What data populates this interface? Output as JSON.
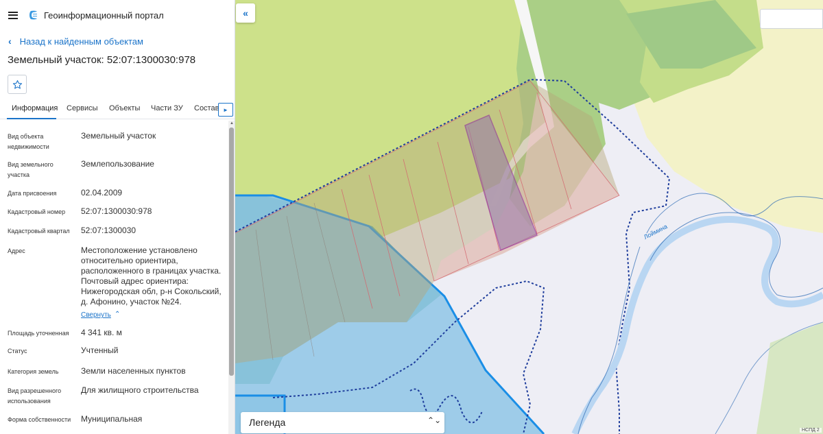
{
  "header": {
    "portal_title": "Геоинформационный портал"
  },
  "nav": {
    "back_label": "Назад к найденным объектам"
  },
  "object": {
    "title": "Земельный участок: 52:07:1300030:978"
  },
  "tabs": [
    {
      "label": "Информация",
      "active": true
    },
    {
      "label": "Сервисы",
      "active": false
    },
    {
      "label": "Объекты",
      "active": false
    },
    {
      "label": "Части ЗУ",
      "active": false
    },
    {
      "label": "Состав",
      "active": false
    }
  ],
  "info": [
    {
      "key": "Вид объекта недвижимости",
      "value": "Земельный участок"
    },
    {
      "key": "Вид земельного участка",
      "value": "Землепользование"
    },
    {
      "key": "Дата присвоения",
      "value": "02.04.2009"
    },
    {
      "key": "Кадастровый номер",
      "value": "52:07:1300030:978"
    },
    {
      "key": "Кадастровый квартал",
      "value": "52:07:1300030"
    },
    {
      "key": "Адрес",
      "value": "Местоположение установлено относительно ориентира, расположенного в границах участка. Почтовый адрес ориентира: Нижегородская обл, р-н Сокольский, д. Афонино, участок №24."
    },
    {
      "key": "Площадь уточненная",
      "value": "4 341 кв. м"
    },
    {
      "key": "Статус",
      "value": "Учтенный"
    },
    {
      "key": "Категория земель",
      "value": "Земли населенных пунктов"
    },
    {
      "key": "Вид разрешенного использования",
      "value": "Для жилищного строительства"
    },
    {
      "key": "Форма собственности",
      "value": "Муниципальная"
    }
  ],
  "collapse_label": "Свернуть",
  "map": {
    "legend_label": "Легенда",
    "river_label": "Лоймина",
    "scale_label": "НСПД 2"
  },
  "icons": {
    "menu": "hamburger-icon",
    "logo": "portal-logo-icon",
    "back": "chevron-left-icon",
    "favorite": "star-icon",
    "tabs_next": "triangle-right-icon",
    "collapse_panel": "double-chevron-left-icon",
    "collapse_address": "chevron-up-icon",
    "legend_toggle": "updown-chevron-icon"
  },
  "colors": {
    "accent": "#1a73c9"
  }
}
